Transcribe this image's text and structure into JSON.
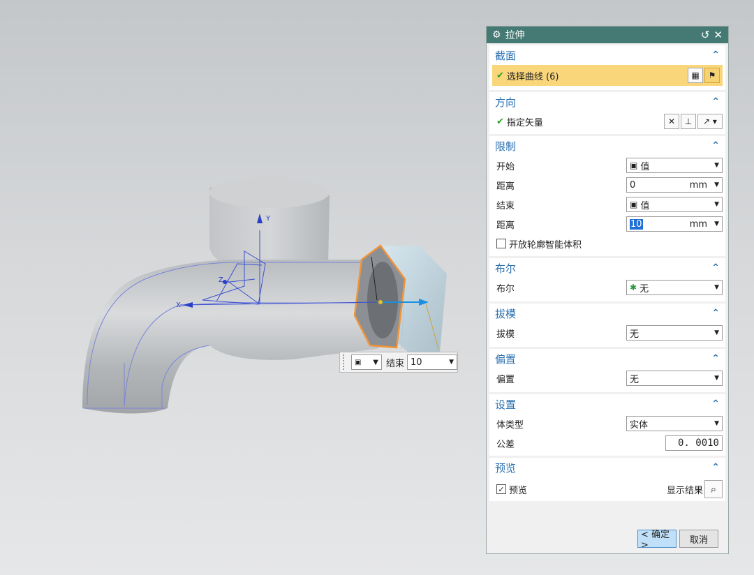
{
  "viewport": {
    "axis_labels": {
      "x": "X",
      "y": "Y",
      "z": "Z"
    }
  },
  "float_input": {
    "label": "结束",
    "value": "10"
  },
  "dialog": {
    "title": "拉伸",
    "sections": {
      "section": {
        "title": "截面",
        "select_curve": "选择曲线 (6)"
      },
      "direction": {
        "title": "方向",
        "specify_vector": "指定矢量"
      },
      "limits": {
        "title": "限制",
        "start_label": "开始",
        "start_value": "值",
        "start_dist_label": "距离",
        "start_dist_value": "0",
        "start_dist_unit": "mm",
        "end_label": "结束",
        "end_value": "值",
        "end_dist_label": "距离",
        "end_dist_value": "10",
        "end_dist_unit": "mm",
        "open_profile": "开放轮廓智能体积"
      },
      "boolean": {
        "title": "布尔",
        "label": "布尔",
        "value": "无"
      },
      "draft": {
        "title": "拔模",
        "label": "拔模",
        "value": "无"
      },
      "offset": {
        "title": "偏置",
        "label": "偏置",
        "value": "无"
      },
      "settings": {
        "title": "设置",
        "body_type_label": "体类型",
        "body_type_value": "实体",
        "tolerance_label": "公差",
        "tolerance_value": "0. 0010"
      },
      "preview": {
        "title": "预览",
        "preview_label": "预览",
        "show_result": "显示结果"
      }
    },
    "buttons": {
      "ok": "< 确定 >",
      "cancel": "取消"
    }
  }
}
